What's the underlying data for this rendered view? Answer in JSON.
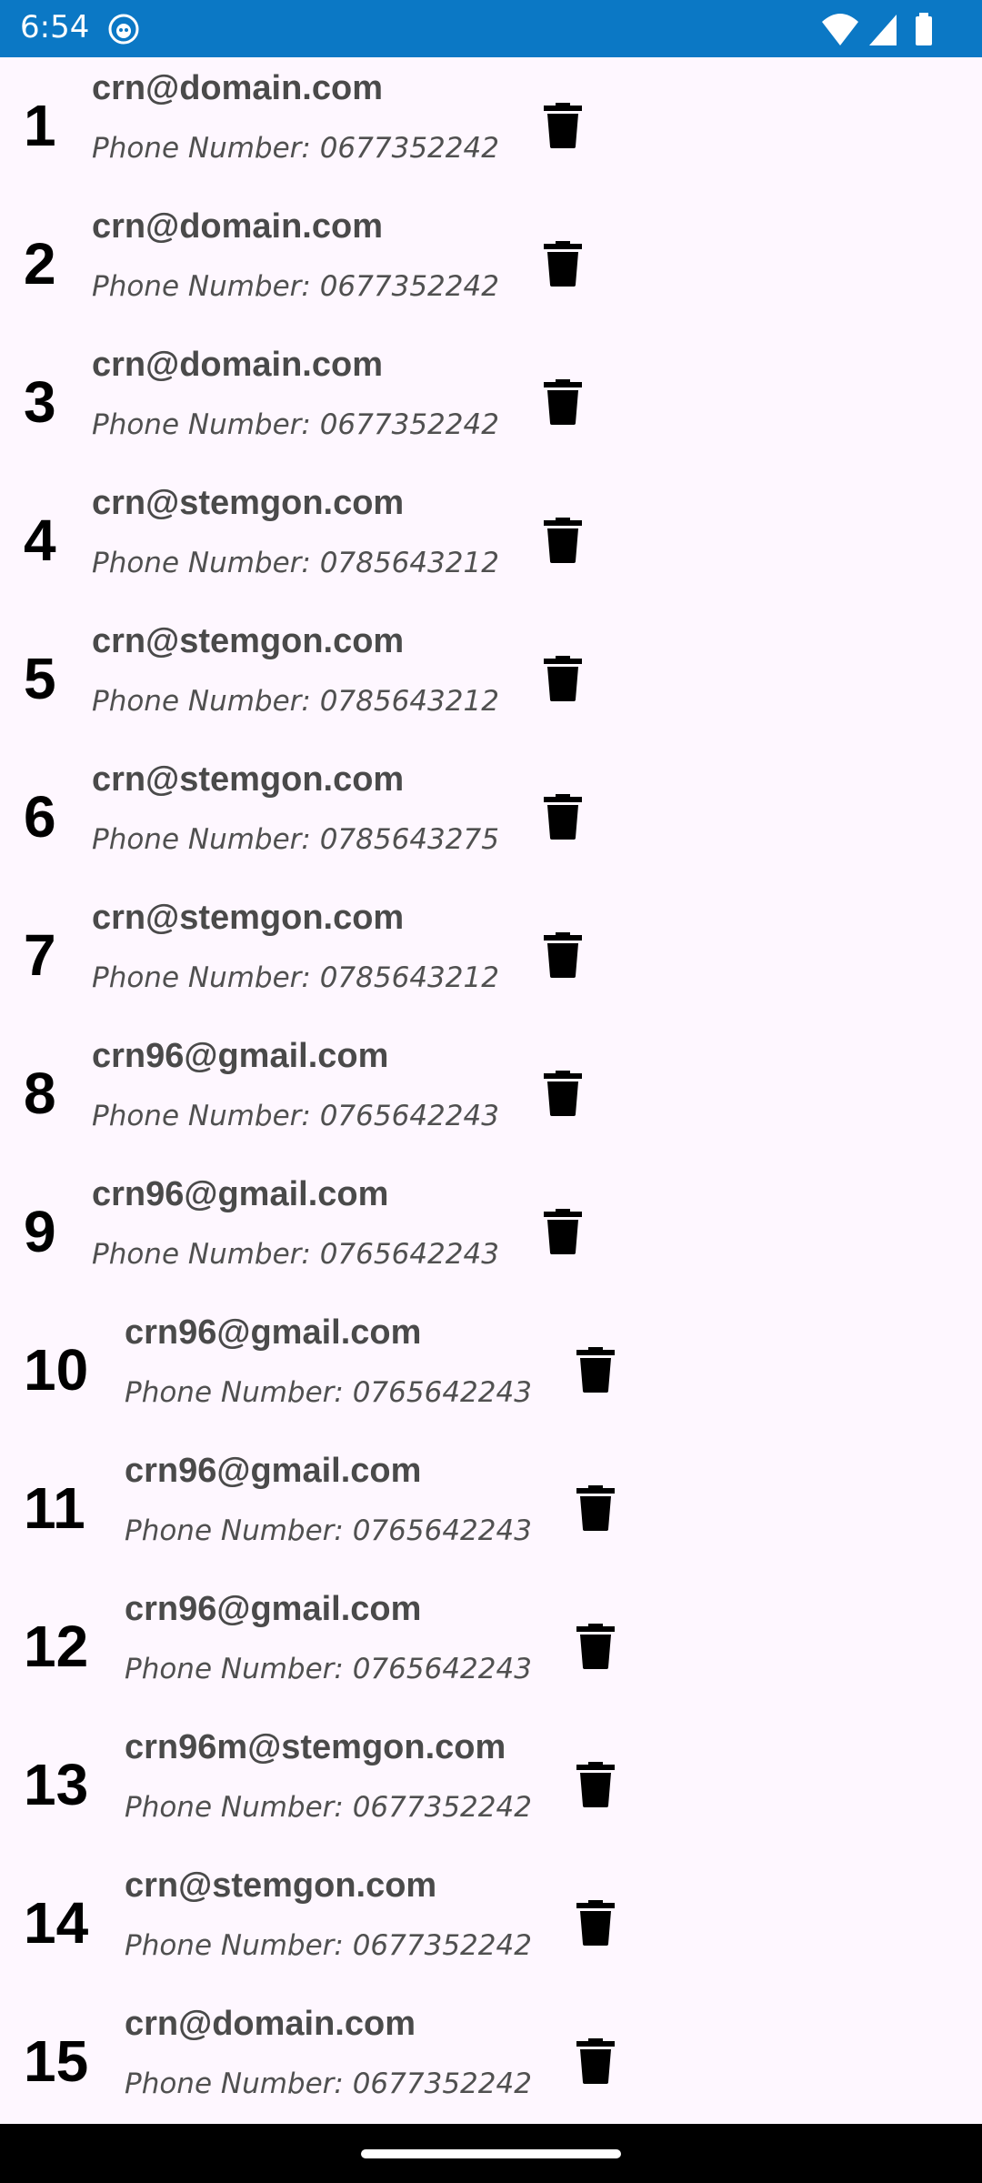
{
  "status_bar": {
    "time": "6:54",
    "icons": [
      "app-notification-icon",
      "wifi-icon",
      "cellular-signal-icon",
      "battery-icon"
    ]
  },
  "contacts": [
    {
      "index": "1",
      "email": "crn@domain.com",
      "phone": "Phone Number: 0677352242"
    },
    {
      "index": "2",
      "email": "crn@domain.com",
      "phone": "Phone Number: 0677352242"
    },
    {
      "index": "3",
      "email": "crn@domain.com",
      "phone": "Phone Number: 0677352242"
    },
    {
      "index": "4",
      "email": "crn@stemgon.com",
      "phone": "Phone Number: 0785643212"
    },
    {
      "index": "5",
      "email": "crn@stemgon.com",
      "phone": "Phone Number: 0785643212"
    },
    {
      "index": "6",
      "email": "crn@stemgon.com",
      "phone": "Phone Number: 0785643275"
    },
    {
      "index": "7",
      "email": "crn@stemgon.com",
      "phone": "Phone Number: 0785643212"
    },
    {
      "index": "8",
      "email": "crn96@gmail.com",
      "phone": "Phone Number: 0765642243"
    },
    {
      "index": "9",
      "email": "crn96@gmail.com",
      "phone": "Phone Number: 0765642243"
    },
    {
      "index": "10",
      "email": "crn96@gmail.com",
      "phone": "Phone Number: 0765642243"
    },
    {
      "index": "11",
      "email": "crn96@gmail.com",
      "phone": "Phone Number: 0765642243"
    },
    {
      "index": "12",
      "email": "crn96@gmail.com",
      "phone": "Phone Number: 0765642243"
    },
    {
      "index": "13",
      "email": "crn96m@stemgon.com",
      "phone": "Phone Number: 0677352242"
    },
    {
      "index": "14",
      "email": "crn@stemgon.com",
      "phone": "Phone Number: 0677352242"
    },
    {
      "index": "15",
      "email": "crn@domain.com",
      "phone": "Phone Number: 0677352242"
    }
  ],
  "colors": {
    "status_bar": "#0B78C5",
    "background": "#FEF7FF",
    "email_text": "#4a4a4a",
    "phone_text": "#505050"
  }
}
